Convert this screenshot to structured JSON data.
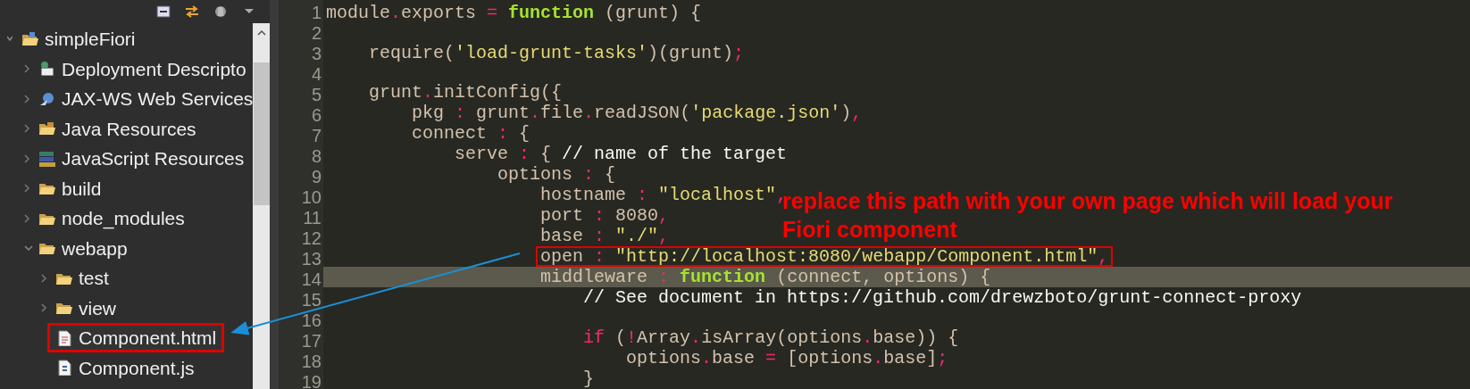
{
  "explorer": {
    "tree": [
      {
        "label": "simpleFiori",
        "kind": "project",
        "expanded": true,
        "children": [
          {
            "label": "Deployment Descripto",
            "kind": "descriptor",
            "expanded": false
          },
          {
            "label": "JAX-WS Web Services",
            "kind": "webservices",
            "expanded": false
          },
          {
            "label": "Java Resources",
            "kind": "java",
            "expanded": false
          },
          {
            "label": "JavaScript Resources",
            "kind": "javascript",
            "expanded": false
          },
          {
            "label": "build",
            "kind": "folder",
            "expanded": false
          },
          {
            "label": "node_modules",
            "kind": "folder",
            "expanded": false
          },
          {
            "label": "webapp",
            "kind": "folder",
            "expanded": true,
            "children": [
              {
                "label": "test",
                "kind": "folder",
                "expanded": false
              },
              {
                "label": "view",
                "kind": "folder",
                "expanded": false
              },
              {
                "label": "Component.html",
                "kind": "html-file",
                "highlighted": true
              },
              {
                "label": "Component.js",
                "kind": "js-file",
                "highlighted": false
              }
            ]
          }
        ]
      }
    ]
  },
  "editor": {
    "lines": [
      {
        "number": "1",
        "current": false,
        "boxed": false,
        "tokens": [
          {
            "kind": "id",
            "text": "module"
          },
          {
            "kind": "op",
            "text": "."
          },
          {
            "kind": "id",
            "text": "exports "
          },
          {
            "kind": "op",
            "text": "="
          },
          {
            "kind": "kw",
            "text": " function "
          },
          {
            "kind": "id",
            "text": "(grunt) {"
          }
        ]
      },
      {
        "number": "2",
        "current": false,
        "boxed": false
      },
      {
        "number": "3",
        "current": false,
        "boxed": false,
        "tokens": [
          {
            "kind": "id",
            "text": "    require("
          },
          {
            "kind": "str",
            "text": "'load-grunt-tasks'"
          },
          {
            "kind": "id",
            "text": ")(grunt)"
          },
          {
            "kind": "op",
            "text": ";"
          }
        ]
      },
      {
        "number": "4",
        "current": false,
        "boxed": false
      },
      {
        "number": "5",
        "current": false,
        "boxed": false,
        "tokens": [
          {
            "kind": "id",
            "text": "    grunt"
          },
          {
            "kind": "op",
            "text": "."
          },
          {
            "kind": "id",
            "text": "initConfig({"
          }
        ]
      },
      {
        "number": "6",
        "current": false,
        "boxed": false,
        "tokens": [
          {
            "kind": "id",
            "text": "        pkg "
          },
          {
            "kind": "op",
            "text": ":"
          },
          {
            "kind": "id",
            "text": " grunt"
          },
          {
            "kind": "op",
            "text": "."
          },
          {
            "kind": "id",
            "text": "file"
          },
          {
            "kind": "op",
            "text": "."
          },
          {
            "kind": "id",
            "text": "readJSON("
          },
          {
            "kind": "str",
            "text": "'package.json'"
          },
          {
            "kind": "id",
            "text": ")"
          },
          {
            "kind": "op",
            "text": ","
          }
        ]
      },
      {
        "number": "7",
        "current": false,
        "boxed": false,
        "tokens": [
          {
            "kind": "id",
            "text": "        connect "
          },
          {
            "kind": "op",
            "text": ":"
          },
          {
            "kind": "id",
            "text": " {"
          }
        ]
      },
      {
        "number": "8",
        "current": false,
        "boxed": false,
        "tokens": [
          {
            "kind": "id",
            "text": "            serve "
          },
          {
            "kind": "op",
            "text": ":"
          },
          {
            "kind": "id",
            "text": " { "
          },
          {
            "kind": "comment",
            "text": "// name of the target"
          }
        ]
      },
      {
        "number": "9",
        "current": false,
        "boxed": false,
        "tokens": [
          {
            "kind": "id",
            "text": "                options "
          },
          {
            "kind": "op",
            "text": ":"
          },
          {
            "kind": "id",
            "text": " {"
          }
        ]
      },
      {
        "number": "10",
        "current": false,
        "boxed": false,
        "tokens": [
          {
            "kind": "id",
            "text": "                    hostname "
          },
          {
            "kind": "op",
            "text": ":"
          },
          {
            "kind": "str",
            "text": " \"localhost\""
          },
          {
            "kind": "op",
            "text": ","
          }
        ]
      },
      {
        "number": "11",
        "current": false,
        "boxed": false,
        "tokens": [
          {
            "kind": "id",
            "text": "                    port "
          },
          {
            "kind": "op",
            "text": ":"
          },
          {
            "kind": "num",
            "text": " 8080"
          },
          {
            "kind": "op",
            "text": ","
          }
        ]
      },
      {
        "number": "12",
        "current": false,
        "boxed": false,
        "tokens": [
          {
            "kind": "id",
            "text": "                    base "
          },
          {
            "kind": "op",
            "text": ":"
          },
          {
            "kind": "str",
            "text": " \"./\""
          },
          {
            "kind": "op",
            "text": ","
          }
        ]
      },
      {
        "number": "13",
        "current": false,
        "boxed": true,
        "tokens": [
          {
            "kind": "id",
            "text": "                    open "
          },
          {
            "kind": "op",
            "text": ":"
          },
          {
            "kind": "str",
            "text": " \"http://localhost:8080/webapp/Component.html\""
          },
          {
            "kind": "op",
            "text": ","
          }
        ]
      },
      {
        "number": "14",
        "current": true,
        "boxed": false,
        "tokens": [
          {
            "kind": "id",
            "text": "                    middleware "
          },
          {
            "kind": "op",
            "text": ":"
          },
          {
            "kind": "kw",
            "text": " function "
          },
          {
            "kind": "id",
            "text": "(connect, options) {"
          }
        ]
      },
      {
        "number": "15",
        "current": false,
        "boxed": false,
        "tokens": [
          {
            "kind": "comment",
            "text": "                        // See document in https://github.com/drewzboto/grunt-connect-proxy"
          }
        ]
      },
      {
        "number": "16",
        "current": false,
        "boxed": false
      },
      {
        "number": "17",
        "current": false,
        "boxed": false,
        "tokens": [
          {
            "kind": "op",
            "text": "                        if"
          },
          {
            "kind": "id",
            "text": " ("
          },
          {
            "kind": "op",
            "text": "!"
          },
          {
            "kind": "id",
            "text": "Array"
          },
          {
            "kind": "op",
            "text": "."
          },
          {
            "kind": "id",
            "text": "isArray(options"
          },
          {
            "kind": "op",
            "text": "."
          },
          {
            "kind": "id",
            "text": "base)) {"
          }
        ]
      },
      {
        "number": "18",
        "current": false,
        "boxed": false,
        "tokens": [
          {
            "kind": "id",
            "text": "                            options"
          },
          {
            "kind": "op",
            "text": "."
          },
          {
            "kind": "id",
            "text": "base "
          },
          {
            "kind": "op",
            "text": "="
          },
          {
            "kind": "id",
            "text": " [options"
          },
          {
            "kind": "op",
            "text": "."
          },
          {
            "kind": "id",
            "text": "base]"
          },
          {
            "kind": "op",
            "text": ";"
          }
        ]
      },
      {
        "number": "19",
        "current": false,
        "boxed": false,
        "tokens": [
          {
            "kind": "id",
            "text": "                        }"
          }
        ]
      }
    ]
  },
  "annotation": {
    "text": "replace this path with your own page which will load your Fiori component"
  }
}
